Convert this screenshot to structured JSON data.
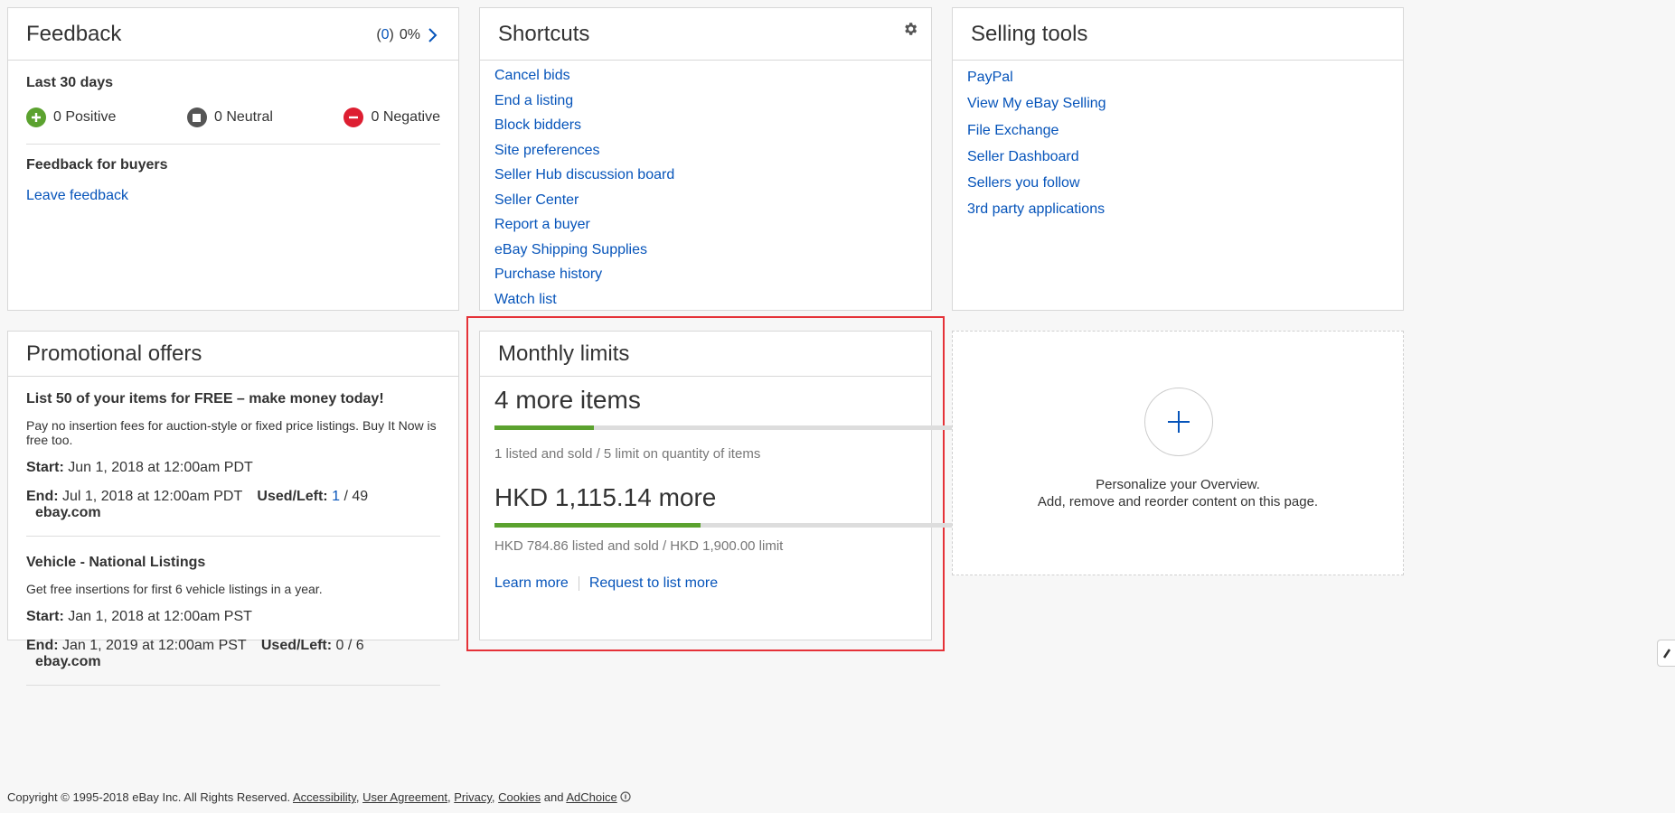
{
  "feedback": {
    "title": "Feedback",
    "count_open": "(",
    "count": "0",
    "count_close": ")",
    "percent": "0%",
    "last30": "Last 30 days",
    "positive": "0 Positive",
    "neutral": "0 Neutral",
    "negative": "0 Negative",
    "for_buyers": "Feedback for buyers",
    "leave": "Leave feedback"
  },
  "shortcuts": {
    "title": "Shortcuts",
    "items": [
      "Cancel bids",
      "End a listing",
      "Block bidders",
      "Site preferences",
      "Seller Hub discussion board",
      "Seller Center",
      "Report a buyer",
      "eBay Shipping Supplies",
      "Purchase history",
      "Watch list"
    ]
  },
  "selling_tools": {
    "title": "Selling tools",
    "items": [
      "PayPal",
      "View My eBay Selling",
      "File Exchange",
      "Seller Dashboard",
      "Sellers you follow",
      "3rd party applications"
    ]
  },
  "promotional": {
    "title": "Promotional offers",
    "offers": [
      {
        "title": "List 50 of your items for FREE – make money today!",
        "desc": "Pay no insertion fees for auction-style or fixed price listings. Buy It Now is free too.",
        "start_label": "Start:",
        "start": "Jun 1, 2018 at 12:00am PDT",
        "end_label": "End:",
        "end": "Jul 1, 2018 at 12:00am PDT",
        "used_label": "Used/Left:",
        "used": "1",
        "left": "/ 49",
        "site": "ebay.com"
      },
      {
        "title": "Vehicle - National Listings",
        "desc": "Get free insertions for first 6 vehicle listings in a year.",
        "start_label": "Start:",
        "start": "Jan 1, 2018 at 12:00am PST",
        "end_label": "End:",
        "end": "Jan 1, 2019 at 12:00am PST",
        "used_label": "Used/Left:",
        "used": "0",
        "left": "/ 6",
        "site": "ebay.com"
      }
    ]
  },
  "monthly": {
    "title": "Monthly limits",
    "items_big": "4 more items",
    "items_progress": 0.2,
    "items_sub": "1 listed and sold /  5 limit on quantity of items",
    "value_big": "HKD 1,115.14 more",
    "value_progress": 0.413,
    "value_sub": "HKD 784.86 listed and sold /  HKD 1,900.00 limit",
    "learn_more": "Learn more",
    "request_more": "Request to list more"
  },
  "personalize": {
    "line1": "Personalize your Overview.",
    "line2": "Add, remove and reorder content on this page."
  },
  "footer": {
    "copyright": "Copyright © 1995-2018 eBay Inc. All Rights Reserved.",
    "accessibility": "Accessibility",
    "user_agreement": "User Agreement",
    "privacy": "Privacy",
    "cookies": "Cookies",
    "and": "and",
    "adchoice": "AdChoice"
  },
  "colors": {
    "link": "#0654ba",
    "progress": "#5ba22f",
    "highlight": "#e53238",
    "positive": "#5ba22f",
    "neutral": "#555555",
    "negative": "#dd1e31"
  }
}
